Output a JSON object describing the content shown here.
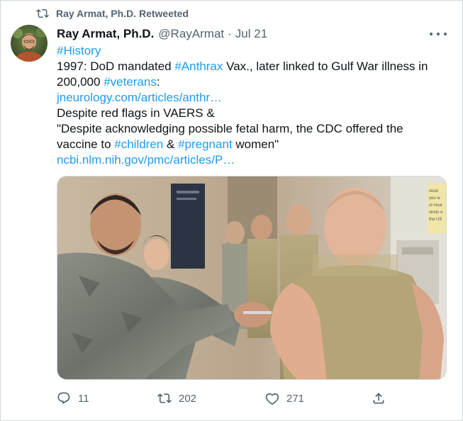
{
  "retweet_banner": {
    "icon": "retweet-icon",
    "label": "Ray Armat, Ph.D. Retweeted"
  },
  "author": {
    "avatar": "avatar-photo",
    "name": "Ray Armat, Ph.D.",
    "handle": "@RayArmat",
    "separator": "·",
    "date": "Jul 21"
  },
  "tweet": {
    "lines": [
      [
        {
          "t": "#History",
          "link": true
        }
      ],
      [
        {
          "t": "1997: DoD mandated "
        },
        {
          "t": "#Anthrax",
          "link": true
        },
        {
          "t": " Vax., later linked to Gulf War illness in"
        }
      ],
      [
        {
          "t": "200,000 "
        },
        {
          "t": "#veterans",
          "link": true
        },
        {
          "t": ":"
        }
      ],
      [
        {
          "t": "jneurology.com/articles/anthr…",
          "link": true
        }
      ],
      [
        {
          "t": "Despite red flags in VAERS &"
        }
      ],
      [
        {
          "t": "\"Despite acknowledging possible fetal harm, the CDC offered the"
        }
      ],
      [
        {
          "t": "vaccine to "
        },
        {
          "t": "#children",
          "link": true
        },
        {
          "t": " & "
        },
        {
          "t": "#pregnant",
          "link": true
        },
        {
          "t": " women\""
        }
      ],
      [
        {
          "t": "ncbi.nlm.nih.gov/pmc/articles/P…",
          "link": true
        }
      ]
    ]
  },
  "media": {
    "poster_text": [
      "recei",
      "you w",
      "or rece",
      "shots o",
      "the US"
    ]
  },
  "actions": {
    "reply_count": "11",
    "retweet_count": "202",
    "like_count": "271"
  },
  "colors": {
    "link": "#1d9bf0",
    "secondary_text": "#536471",
    "border": "#cfd9de"
  }
}
